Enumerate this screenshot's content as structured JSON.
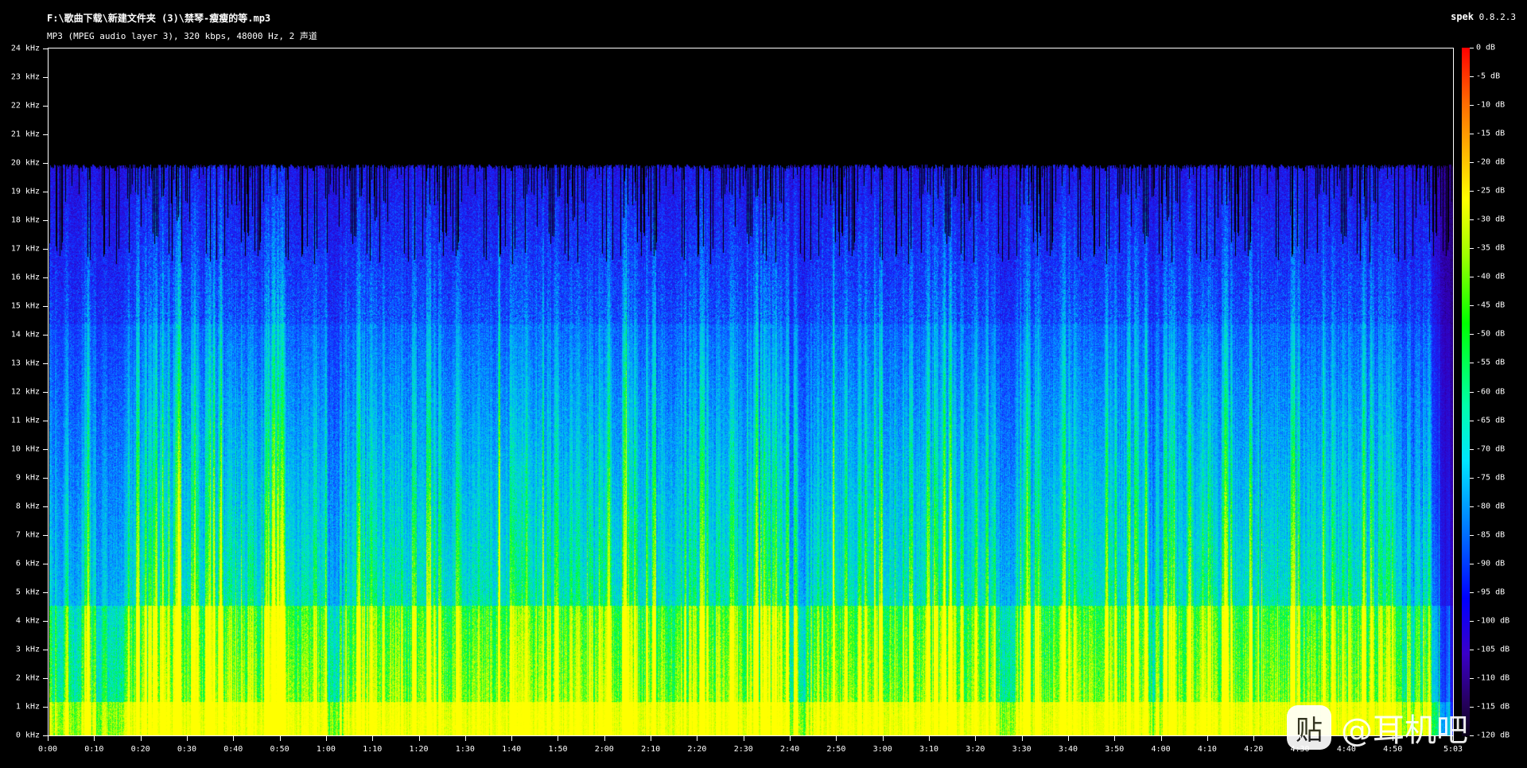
{
  "header": {
    "file_path": "F:\\歌曲下载\\新建文件夹 (3)\\禁琴-瘦瘦的等.mp3",
    "file_info": "MP3 (MPEG audio layer 3), 320 kbps, 48000 Hz, 2 声道"
  },
  "brand": {
    "name": "spek",
    "version": "0.8.2.3"
  },
  "frequency_axis": {
    "labels": [
      "0 kHz",
      "1 kHz",
      "2 kHz",
      "3 kHz",
      "4 kHz",
      "5 kHz",
      "6 kHz",
      "7 kHz",
      "8 kHz",
      "9 kHz",
      "10 kHz",
      "11 kHz",
      "12 kHz",
      "13 kHz",
      "14 kHz",
      "15 kHz",
      "16 kHz",
      "17 kHz",
      "18 kHz",
      "19 kHz",
      "20 kHz",
      "21 kHz",
      "22 kHz",
      "23 kHz",
      "24 kHz"
    ]
  },
  "time_axis": {
    "labels": [
      "0:00",
      "0:10",
      "0:20",
      "0:30",
      "0:40",
      "0:50",
      "1:00",
      "1:10",
      "1:20",
      "1:30",
      "1:40",
      "1:50",
      "2:00",
      "2:10",
      "2:20",
      "2:30",
      "2:40",
      "2:50",
      "3:00",
      "3:10",
      "3:20",
      "3:30",
      "3:40",
      "3:50",
      "4:00",
      "4:10",
      "4:20",
      "4:30",
      "4:40",
      "4:50",
      "5:03"
    ],
    "duration_seconds": 303
  },
  "db_scale": {
    "labels": [
      "0 dB",
      "-5 dB",
      "-10 dB",
      "-15 dB",
      "-20 dB",
      "-25 dB",
      "-30 dB",
      "-35 dB",
      "-40 dB",
      "-45 dB",
      "-50 dB",
      "-55 dB",
      "-60 dB",
      "-65 dB",
      "-70 dB",
      "-75 dB",
      "-80 dB",
      "-85 dB",
      "-90 dB",
      "-95 dB",
      "-100 dB",
      "-105 dB",
      "-110 dB",
      "-115 dB",
      "-120 dB"
    ]
  },
  "watermark": {
    "icon_char": "贴",
    "text": "@耳机吧"
  },
  "colors": {
    "background": "#000000",
    "text": "#ffffff"
  }
}
